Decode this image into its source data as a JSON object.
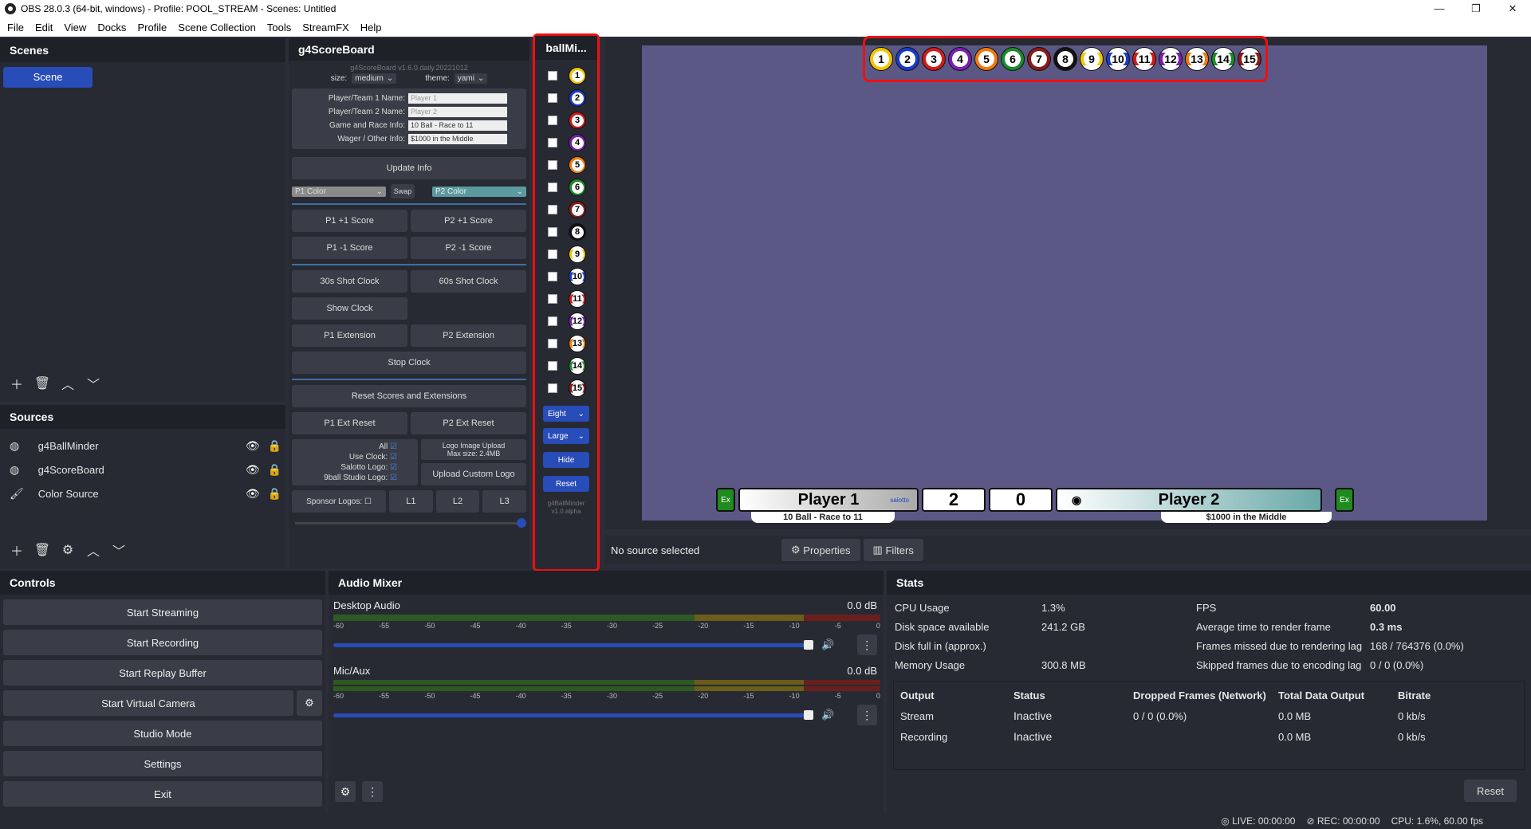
{
  "window": {
    "title": "OBS 28.0.3 (64-bit, windows) - Profile: POOL_STREAM - Scenes: Untitled"
  },
  "menu": [
    "File",
    "Edit",
    "View",
    "Docks",
    "Profile",
    "Scene Collection",
    "Tools",
    "StreamFX",
    "Help"
  ],
  "scenes": {
    "title": "Scenes",
    "items": [
      "Scene"
    ]
  },
  "sources": {
    "title": "Sources",
    "items": [
      "g4BallMinder",
      "g4ScoreBoard",
      "Color Source"
    ]
  },
  "g4": {
    "title": "g4ScoreBoard",
    "version": "g4ScoreBoard v1.6.0.daily.20221012",
    "size_label": "size:",
    "size_value": "medium",
    "theme_label": "theme:",
    "theme_value": "yami",
    "p1_name_label": "Player/Team 1 Name:",
    "p1_name_placeholder": "Player 1",
    "p2_name_label": "Player/Team 2 Name:",
    "p2_name_placeholder": "Player 2",
    "game_label": "Game and Race Info:",
    "game_value": "10 Ball - Race to 11",
    "wager_label": "Wager / Other Info:",
    "wager_value": "$1000 in the Middle",
    "update_info": "Update Info",
    "p1_color": "P1 Color",
    "swap": "Swap",
    "p2_color": "P2 Color",
    "p1_plus": "P1 +1 Score",
    "p2_plus": "P2 +1 Score",
    "p1_minus": "P1 -1 Score",
    "p2_minus": "P2 -1 Score",
    "clock30": "30s Shot Clock",
    "clock60": "60s Shot Clock",
    "show_clock": "Show Clock",
    "p1_ext": "P1 Extension",
    "p2_ext": "P2 Extension",
    "stop_clock": "Stop Clock",
    "reset_scores": "Reset Scores and Extensions",
    "p1_ext_reset": "P1 Ext Reset",
    "p2_ext_reset": "P2 Ext Reset",
    "all": "All",
    "use_clock": "Use Clock:",
    "salotto_logo": "Salotto Logo:",
    "nineball_logo": "9ball Studio Logo:",
    "logo_upload": "Logo Image Upload",
    "logo_max": "Max size: 2.4MB",
    "upload_custom": "Upload Custom Logo",
    "sponsor": "Sponsor Logos:",
    "l1": "L1",
    "l2": "L2",
    "l3": "L3"
  },
  "ballminder": {
    "title": "ballMi...",
    "game_select": "Eight",
    "size_select": "Large",
    "hide": "Hide",
    "reset": "Reset",
    "footer1": "g4BallMinder",
    "footer2": "v1.0.alpha"
  },
  "balls": [
    {
      "n": "1",
      "color": "#f2c500",
      "stripe": false
    },
    {
      "n": "2",
      "color": "#1a3cc8",
      "stripe": false
    },
    {
      "n": "3",
      "color": "#d11a1a",
      "stripe": false
    },
    {
      "n": "4",
      "color": "#7a1fb0",
      "stripe": false
    },
    {
      "n": "5",
      "color": "#f07a10",
      "stripe": false
    },
    {
      "n": "6",
      "color": "#1a8a2a",
      "stripe": false
    },
    {
      "n": "7",
      "color": "#8a1a1a",
      "stripe": false
    },
    {
      "n": "8",
      "color": "#111111",
      "stripe": false
    },
    {
      "n": "9",
      "color": "#f2c500",
      "stripe": true
    },
    {
      "n": "10",
      "color": "#1a3cc8",
      "stripe": true
    },
    {
      "n": "11",
      "color": "#d11a1a",
      "stripe": true
    },
    {
      "n": "12",
      "color": "#7a1fb0",
      "stripe": true
    },
    {
      "n": "13",
      "color": "#f07a10",
      "stripe": true
    },
    {
      "n": "14",
      "color": "#1a8a2a",
      "stripe": true
    },
    {
      "n": "15",
      "color": "#8a1a1a",
      "stripe": true
    }
  ],
  "overlay": {
    "ex": "Ex",
    "p1_name": "Player 1",
    "p2_name": "Player 2",
    "p1_score": "2",
    "p2_score": "0",
    "race": "10 Ball - Race to 11",
    "wager": "$1000 in the Middle",
    "sponsor_text": "salotto"
  },
  "properties": {
    "no_source": "No source selected",
    "properties": "Properties",
    "filters": "Filters"
  },
  "controls": {
    "title": "Controls",
    "start_streaming": "Start Streaming",
    "start_recording": "Start Recording",
    "start_replay": "Start Replay Buffer",
    "start_virtual": "Start Virtual Camera",
    "studio_mode": "Studio Mode",
    "settings": "Settings",
    "exit": "Exit"
  },
  "mixer": {
    "title": "Audio Mixer",
    "channels": [
      {
        "name": "Desktop Audio",
        "db": "0.0 dB"
      },
      {
        "name": "Mic/Aux",
        "db": "0.0 dB"
      }
    ],
    "ticks": [
      "-60",
      "-55",
      "-50",
      "-45",
      "-40",
      "-35",
      "-30",
      "-25",
      "-20",
      "-15",
      "-10",
      "-5",
      "0"
    ]
  },
  "stats": {
    "title": "Stats",
    "cpu_label": "CPU Usage",
    "cpu": "1.3%",
    "disk_label": "Disk space available",
    "disk": "241.2 GB",
    "diskfull_label": "Disk full in (approx.)",
    "diskfull": "",
    "mem_label": "Memory Usage",
    "mem": "300.8 MB",
    "fps_label": "FPS",
    "fps": "60.00",
    "render_label": "Average time to render frame",
    "render": "0.3 ms",
    "missed_label": "Frames missed due to rendering lag",
    "missed": "168 / 764376 (0.0%)",
    "skipped_label": "Skipped frames due to encoding lag",
    "skipped": "0 / 0 (0.0%)",
    "headers": [
      "Output",
      "Status",
      "Dropped Frames (Network)",
      "Total Data Output",
      "Bitrate"
    ],
    "rows": [
      [
        "Stream",
        "Inactive",
        "0 / 0 (0.0%)",
        "0.0 MB",
        "0 kb/s"
      ],
      [
        "Recording",
        "Inactive",
        "",
        "0.0 MB",
        "0 kb/s"
      ]
    ],
    "reset": "Reset"
  },
  "status": {
    "live": "LIVE: 00:00:00",
    "rec": "REC: 00:00:00",
    "cpu": "CPU: 1.6%, 60.00 fps"
  }
}
